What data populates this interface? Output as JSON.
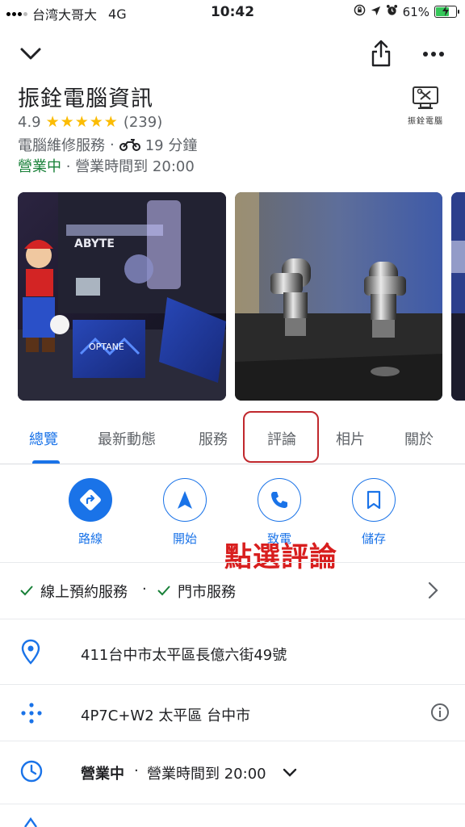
{
  "status_bar": {
    "carrier": "台湾大哥大",
    "network": "4G",
    "time": "10:42",
    "battery": "61%",
    "battery_level": 0.61
  },
  "header": {
    "business_name": "振銓電腦資訊",
    "rating": "4.9",
    "stars": "★★★★★",
    "review_count": "(239)",
    "category": "電腦維修服務",
    "travel_time": "19 分鐘",
    "open_status": "營業中",
    "hours": "營業時間到 20:00",
    "logo_text": "振銓電腦"
  },
  "photos": {
    "photo1_texts": [
      "ABYTE",
      "OPTANE"
    ]
  },
  "tabs": [
    {
      "label": "總覽"
    },
    {
      "label": "最新動態"
    },
    {
      "label": "服務"
    },
    {
      "label": "評論"
    },
    {
      "label": "相片"
    },
    {
      "label": "關於"
    }
  ],
  "actions": [
    {
      "label": "路線",
      "icon": "directions-icon"
    },
    {
      "label": "開始",
      "icon": "navigation-icon"
    },
    {
      "label": "致電",
      "icon": "phone-icon"
    },
    {
      "label": "儲存",
      "icon": "bookmark-icon"
    }
  ],
  "annotation": "點選評論",
  "info": {
    "services": "線上預約服務",
    "services2": "門市服務",
    "address": "411台中市太平區長億六街49號",
    "plus_code": "4P7C+W2 太平區 台中市",
    "hours_status": "營業中",
    "hours_text": "營業時間到 20:00"
  },
  "colors": {
    "accent": "#1a73e8",
    "open_green": "#188038",
    "star": "#fbbc04",
    "annotation_red": "#d81e1e"
  }
}
